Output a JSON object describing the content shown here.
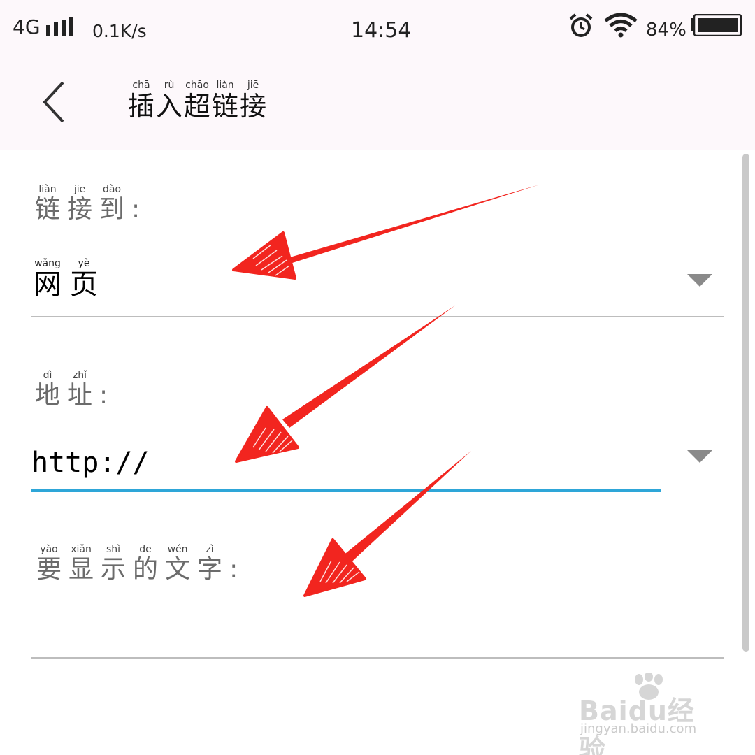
{
  "status_bar": {
    "network": "4G",
    "speed": "0.1K/s",
    "time": "14:54",
    "battery": "84%",
    "icons": [
      "signal-icon",
      "alarm-icon",
      "wifi-icon",
      "battery-icon"
    ]
  },
  "header": {
    "back_icon": "chevron-left-icon",
    "title": [
      {
        "py": "chā",
        "hz": "插"
      },
      {
        "py": "rù",
        "hz": "入"
      },
      {
        "py": "chāo",
        "hz": "超"
      },
      {
        "py": "liàn",
        "hz": "链"
      },
      {
        "py": "jiē",
        "hz": "接"
      }
    ]
  },
  "form": {
    "link_to_label": [
      {
        "py": "liàn",
        "hz": "链"
      },
      {
        "py": "jiē",
        "hz": "接"
      },
      {
        "py": "dào",
        "hz": "到"
      }
    ],
    "link_to_value": [
      {
        "py": "wǎng",
        "hz": "网"
      },
      {
        "py": "yè",
        "hz": "页"
      }
    ],
    "address_label": [
      {
        "py": "dì",
        "hz": "地"
      },
      {
        "py": "zhǐ",
        "hz": "址"
      }
    ],
    "address_value": "http://",
    "display_text_label": [
      {
        "py": "yào",
        "hz": "要"
      },
      {
        "py": "xiǎn",
        "hz": "显"
      },
      {
        "py": "shì",
        "hz": "示"
      },
      {
        "py": "de",
        "hz": "的"
      },
      {
        "py": "wén",
        "hz": "文"
      },
      {
        "py": "zì",
        "hz": "字"
      }
    ],
    "colon": ":",
    "display_text_value": ""
  },
  "colors": {
    "accent": "#2ea6d8",
    "annotation_arrow": "#f2251f",
    "header_bg": "#fdf8fb"
  },
  "watermark": {
    "brand": "Baidu经验",
    "url": "jingyan.baidu.com"
  }
}
